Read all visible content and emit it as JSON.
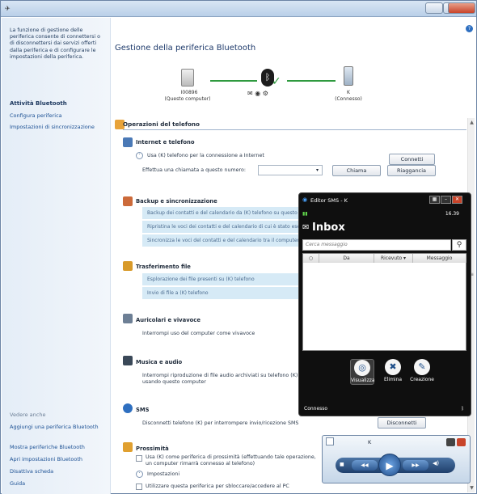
{
  "window": {
    "title_glyph": "✈",
    "controls": [
      "–",
      "▢",
      "✕"
    ]
  },
  "sidebar": {
    "description": "La funzione di gestione delle periferica consente di connettersi o di disconnettersi dai servizi offerti dalla periferica e di configurare le impostazioni della periferica.",
    "heading": "Attività Bluetooth",
    "links": [
      "Configura periferica",
      "Impostazioni di sincronizzazione"
    ],
    "see_also": "Vedere anche",
    "see_also_links": [
      "Aggiungi una periferica Bluetooth",
      "Mostra periferiche Bluetooth",
      "Apri impostazioni Bluetooth",
      "Disattiva scheda",
      "Guida"
    ]
  },
  "header": {
    "title": "Gestione della periferica Bluetooth",
    "help": "?"
  },
  "devices": {
    "computer_name": "I00896",
    "computer_caption": "(Questo computer)",
    "phone_name": "K",
    "phone_caption": "(Connesso)"
  },
  "ops": {
    "heading": "Operazioni del telefono",
    "internet": {
      "title": "Internet e telefono",
      "option": "Usa (K) telefono per la connessione a Internet",
      "connect": "Connetti",
      "call_label": "Effettua una chiamata a questo numero:",
      "call_button": "Chiama",
      "hangup_button": "Riaggancia"
    },
    "backup": {
      "title": "Backup e sincronizzazione",
      "rows": [
        "Backup dei contatti e del calendario da (K) telefono su questo computer",
        "Ripristina le voci dei contatti e del calendario di cui è stato eseguito il backup",
        "Sincronizza le voci del contatti e del calendario tra il computer e il telefono"
      ]
    },
    "transfer": {
      "title": "Trasferimento file",
      "rows": [
        "Esplorazione dei file presenti su (K) telefono",
        "Invio di file a (K) telefono"
      ]
    },
    "headset": {
      "title": "Auricolari e vivavoce",
      "text": "Interrompi uso del computer come vivavoce"
    },
    "music": {
      "title": "Musica e audio",
      "text": "Interrompi riproduzione di file audio archiviati su telefono (K) usando questo computer"
    },
    "sms": {
      "title": "SMS",
      "text": "Disconnetti telefono (K) per interrompere invio/ricezione SMS",
      "button": "Disconnetti"
    },
    "proximity": {
      "title": "Prossimità",
      "option": "Usa (K) come periferica di prossimità (effettuando tale operazione, un computer rimarrà connesso al telefono)",
      "settings": "Impostazioni",
      "unlock": "Utilizzare questa periferica per sbloccare/accedere al PC"
    }
  },
  "sms_editor": {
    "title": "Editor SMS - K",
    "time": "16.39",
    "inbox": "Inbox",
    "search_placeholder": "Cerca messaggio",
    "columns": [
      "Da",
      "Ricevuto ▾",
      "Messaggio"
    ],
    "actions": [
      "Visualizza",
      "Elimina",
      "Creazione"
    ],
    "status": "Connesso"
  },
  "player": {
    "title": "K"
  }
}
